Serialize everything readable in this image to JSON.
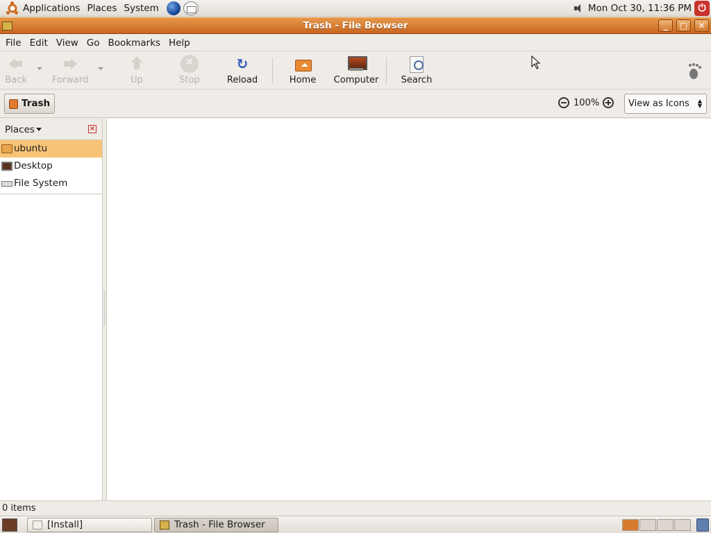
{
  "top_panel": {
    "menus": [
      "Applications",
      "Places",
      "System"
    ],
    "clock": "Mon Oct 30, 11:36 PM"
  },
  "window": {
    "title": "Trash - File Browser",
    "buttons": {
      "minimize": "_",
      "maximize": "□",
      "close": "✕"
    }
  },
  "menubar": [
    "File",
    "Edit",
    "View",
    "Go",
    "Bookmarks",
    "Help"
  ],
  "toolbar": {
    "back": "Back",
    "forward": "Forward",
    "up": "Up",
    "stop": "Stop",
    "reload": "Reload",
    "home": "Home",
    "computer": "Computer",
    "search": "Search"
  },
  "location": {
    "crumb": "Trash",
    "zoom": "100%",
    "view_mode": "View as Icons"
  },
  "sidebar": {
    "title": "Places",
    "items": [
      {
        "label": "ubuntu",
        "icon": "home-folder-icon",
        "selected": true
      },
      {
        "label": "Desktop",
        "icon": "desktop-icon",
        "selected": false
      },
      {
        "label": "File System",
        "icon": "drive-icon",
        "selected": false
      }
    ]
  },
  "status": "0 items",
  "taskbar": {
    "tasks": [
      "[Install]",
      "Trash - File Browser"
    ]
  },
  "colors": {
    "title_bar": "#d77b2f",
    "selection": "#f7c477"
  }
}
